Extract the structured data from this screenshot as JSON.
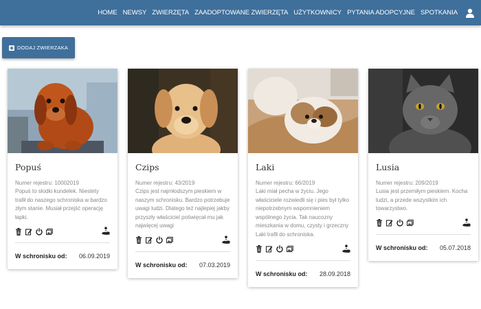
{
  "nav": {
    "items": [
      "HOME",
      "NEWSY",
      "ZWIERZĘTA",
      "ZAADOPTOWANE ZWIERZĘTA",
      "UŻYTKOWNICY",
      "PYTANIA ADOPCYJNE",
      "SPOTKANIA"
    ],
    "user_icon": "user-icon"
  },
  "add_button": {
    "label": "DODAJ ZWIERZAKA",
    "icon": "plus-square-icon"
  },
  "colors": {
    "navbar": "#3f6f9b",
    "button": "#3f6f9b"
  },
  "cards": [
    {
      "name": "Popuś",
      "registration": "Numer rejestru: 10002019",
      "description": "Popuś to słodki kundelek. Niestety trafił do naszego schroniska w bardzo złym stanie. Musiał przejść operację łapki.",
      "since_label": "W schronisku od:",
      "since_date": "06.09.2019",
      "image": "red-puppy-photo"
    },
    {
      "name": "Czips",
      "registration": "Numer rejestru: 43/2019",
      "description": "Czips jest najmłodszym pieskiem w naszym schronisku. Bardzo potrzebuje uwagi ludzi. Dlatego też najlepiej jakby przyszły właściciel poświęcał mu jak najwięcej uwagi",
      "since_label": "W schronisku od:",
      "since_date": "07.03.2019",
      "image": "golden-retriever-puppy-photo"
    },
    {
      "name": "Laki",
      "registration": "Numer rejestru: 66/2019",
      "description": "Laki miał pecha w życiu. Jego właściciele rozwiedli się i pies był tylko niepotrzebnym wspomnieniem wspólnego życia. Tak naucozny mieszkania w domu, czysty i grzeczny Laki trafił do schroniska.",
      "since_label": "W schronisku od:",
      "since_date": "28.09.2018",
      "image": "shih-tzu-photo"
    },
    {
      "name": "Lusia",
      "registration": "Numer rejestru: 209/2019",
      "description": "Lusia jest przemiłym pieskiem. Kocha ludzi, a przede wszystkim ich towarzystwo.",
      "since_label": "W schronisku od:",
      "since_date": "05.07.2018",
      "image": "gray-cat-photo"
    }
  ],
  "card_action_icons": [
    "trash-icon",
    "edit-icon",
    "power-icon",
    "gallery-icon"
  ],
  "card_adopt_icon": "hand-heart-icon"
}
